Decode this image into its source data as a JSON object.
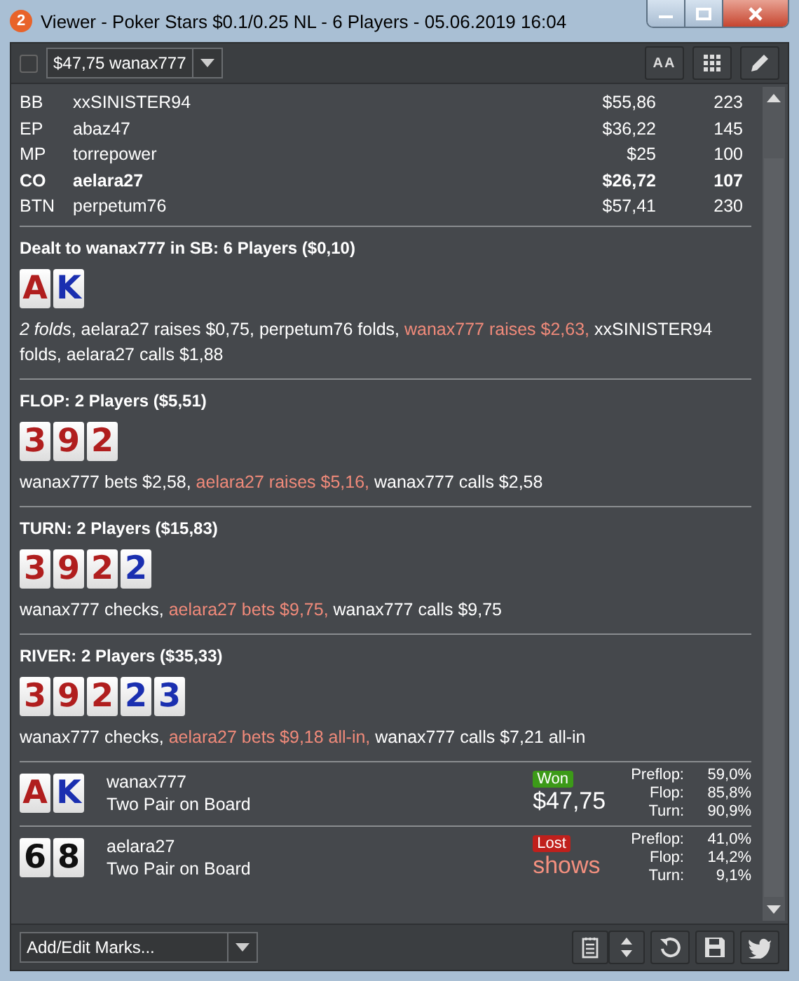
{
  "window": {
    "title": "Viewer - Poker Stars $0.1/0.25 NL - 6 Players - 05.06.2019 16:04",
    "badge": "2"
  },
  "toolbar": {
    "checked": false,
    "hand_select": "$47,75 wanax777",
    "font_button": "AA"
  },
  "players": [
    {
      "position": "BB",
      "name": "xxSINISTER94",
      "stack": "$55,86",
      "bb": "223",
      "highlighted": false
    },
    {
      "position": "EP",
      "name": "abaz47",
      "stack": "$36,22",
      "bb": "145",
      "highlighted": false
    },
    {
      "position": "MP",
      "name": "torrepower",
      "stack": "$25",
      "bb": "100",
      "highlighted": false
    },
    {
      "position": "CO",
      "name": "aelara27",
      "stack": "$26,72",
      "bb": "107",
      "highlighted": true
    },
    {
      "position": "BTN",
      "name": "perpetum76",
      "stack": "$57,41",
      "bb": "230",
      "highlighted": false
    }
  ],
  "streets": [
    {
      "heading": "Dealt to wanax777 in SB: 6 Players ($0,10)",
      "cards": [
        {
          "rank": "A",
          "color": "#b01e1e"
        },
        {
          "rank": "K",
          "color": "#1a2fb0"
        }
      ],
      "actions": [
        {
          "text": "*2 folds*, aelara27 raises $0,75, perpetum76 folds, ",
          "hero": false
        },
        {
          "text": "wanax777 raises $2,63,",
          "hero": true
        },
        {
          "text": " xxSINISTER94 folds, aelara27 calls $1,88",
          "hero": false
        }
      ]
    },
    {
      "heading": "FLOP: 2 Players ($5,51)",
      "cards": [
        {
          "rank": "3",
          "color": "#b01e1e"
        },
        {
          "rank": "9",
          "color": "#b01e1e"
        },
        {
          "rank": "2",
          "color": "#b01e1e"
        }
      ],
      "actions": [
        {
          "text": "wanax777 bets $2,58, ",
          "hero": false
        },
        {
          "text": "aelara27 raises $5,16,",
          "hero": true
        },
        {
          "text": " wanax777 calls $2,58",
          "hero": false
        }
      ]
    },
    {
      "heading": "TURN: 2 Players ($15,83)",
      "cards": [
        {
          "rank": "3",
          "color": "#b01e1e"
        },
        {
          "rank": "9",
          "color": "#b01e1e"
        },
        {
          "rank": "2",
          "color": "#b01e1e"
        },
        {
          "rank": "2",
          "color": "#1a2fb0"
        }
      ],
      "actions": [
        {
          "text": "wanax777 checks, ",
          "hero": false
        },
        {
          "text": "aelara27 bets $9,75,",
          "hero": true
        },
        {
          "text": " wanax777 calls $9,75",
          "hero": false
        }
      ]
    },
    {
      "heading": "RIVER: 2 Players ($35,33)",
      "cards": [
        {
          "rank": "3",
          "color": "#b01e1e"
        },
        {
          "rank": "9",
          "color": "#b01e1e"
        },
        {
          "rank": "2",
          "color": "#b01e1e"
        },
        {
          "rank": "2",
          "color": "#1a2fb0"
        },
        {
          "rank": "3",
          "color": "#1a2fb0"
        }
      ],
      "actions": [
        {
          "text": "wanax777 checks, ",
          "hero": false
        },
        {
          "text": "aelara27 bets $9,18 all-in,",
          "hero": true
        },
        {
          "text": " wanax777 calls $7,21 all-in",
          "hero": false
        }
      ]
    }
  ],
  "results": [
    {
      "cards": [
        {
          "rank": "A",
          "color": "#b01e1e"
        },
        {
          "rank": "K",
          "color": "#1a2fb0"
        }
      ],
      "name": "wanax777",
      "hand": "Two Pair on Board",
      "badge": {
        "text": "Won",
        "kind": "won"
      },
      "amount": "$47,75",
      "equity": [
        {
          "label": "Preflop:",
          "value": "59,0%"
        },
        {
          "label": "Flop:",
          "value": "85,8%"
        },
        {
          "label": "Turn:",
          "value": "90,9%"
        }
      ]
    },
    {
      "cards": [
        {
          "rank": "6",
          "color": "#111111"
        },
        {
          "rank": "8",
          "color": "#111111"
        }
      ],
      "name": "aelara27",
      "hand": "Two Pair on Board",
      "badge": {
        "text": "Lost",
        "kind": "lost"
      },
      "amount": "shows",
      "equity": [
        {
          "label": "Preflop:",
          "value": "41,0%"
        },
        {
          "label": "Flop:",
          "value": "14,2%"
        },
        {
          "label": "Turn:",
          "value": "9,1%"
        }
      ]
    }
  ],
  "bottom_bar": {
    "marks_select": "Add/Edit Marks..."
  }
}
